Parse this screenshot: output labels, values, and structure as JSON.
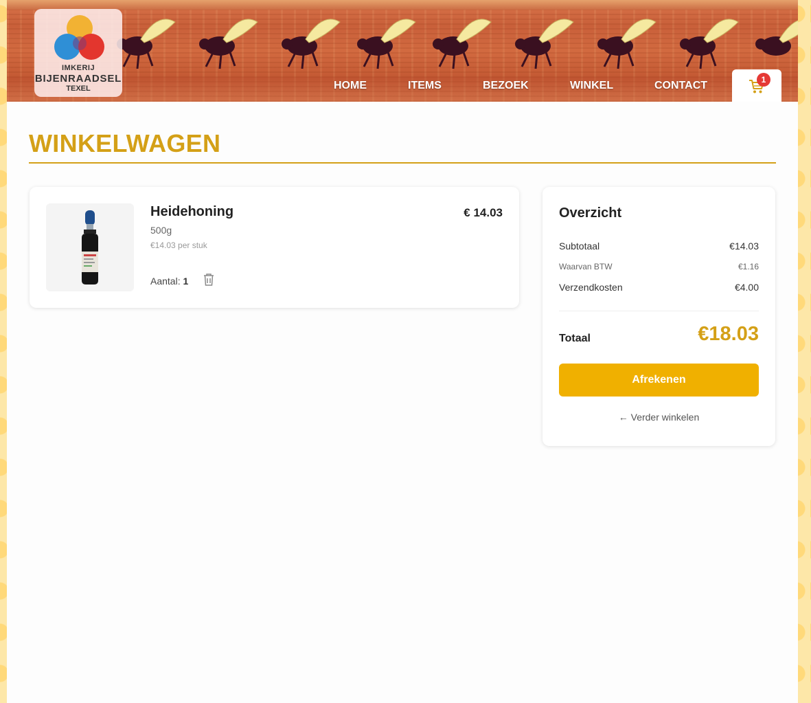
{
  "brand": {
    "logo_line1": "IMKERIJ",
    "logo_line2": "BIJENRAADSEL",
    "logo_line3": "TEXEL"
  },
  "nav": {
    "items": [
      {
        "label": "HOME"
      },
      {
        "label": "ITEMS"
      },
      {
        "label": "BEZOEK"
      },
      {
        "label": "WINKEL"
      },
      {
        "label": "CONTACT"
      }
    ],
    "cart_count": "1"
  },
  "page": {
    "title": "WINKELWAGEN"
  },
  "cart": {
    "items": [
      {
        "name": "Heidehoning",
        "variant": "500g",
        "unit_price": "€14.03 per stuk",
        "line_total": "€ 14.03",
        "qty_label": "Aantal:",
        "qty": "1"
      }
    ]
  },
  "summary": {
    "title": "Overzicht",
    "subtotal_label": "Subtotaal",
    "subtotal": "€14.03",
    "vat_label": "Waarvan BTW",
    "vat": "€1.16",
    "shipping_label": "Verzendkosten",
    "shipping": "€4.00",
    "total_label": "Totaal",
    "total": "€18.03",
    "checkout_label": "Afrekenen",
    "continue_label": "← Verder winkelen"
  },
  "colors": {
    "accent": "#d4a017",
    "button": "#f0b000",
    "badge": "#e53935"
  }
}
